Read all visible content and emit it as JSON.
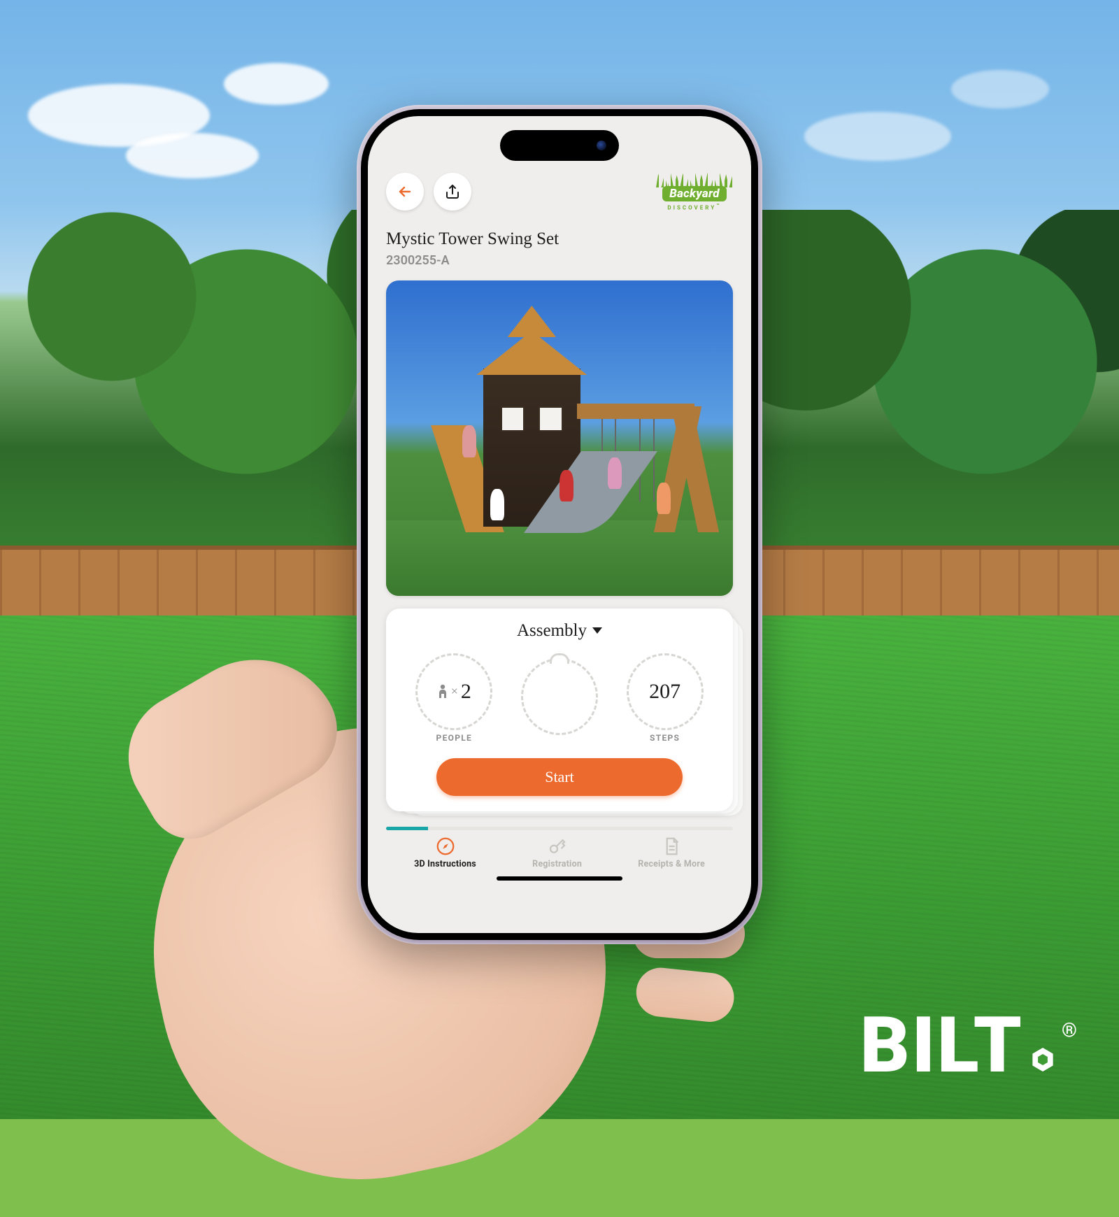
{
  "brand": {
    "name": "Backyard",
    "subtitle": "DISCOVERY",
    "trademark": "™"
  },
  "product": {
    "title": "Mystic Tower Swing Set",
    "sku": "2300255-A"
  },
  "assembly_card": {
    "title": "Assembly",
    "metrics": {
      "people": {
        "prefix": "×",
        "value": "2",
        "label": "PEOPLE"
      },
      "time": {
        "value": "",
        "label": ""
      },
      "steps": {
        "value": "207",
        "label": "STEPS"
      }
    },
    "start_label": "Start",
    "progress_pct": 12
  },
  "bottom_nav": {
    "items": [
      {
        "key": "instructions",
        "label": "3D Instructions",
        "active": true
      },
      {
        "key": "registration",
        "label": "Registration",
        "active": false
      },
      {
        "key": "receipts",
        "label": "Receipts & More",
        "active": false
      }
    ]
  },
  "watermark": {
    "text": "BILT",
    "registered": "®"
  },
  "colors": {
    "accent_orange": "#ed6a2f",
    "teal": "#1aa6a6",
    "brand_green": "#6fae2e"
  }
}
